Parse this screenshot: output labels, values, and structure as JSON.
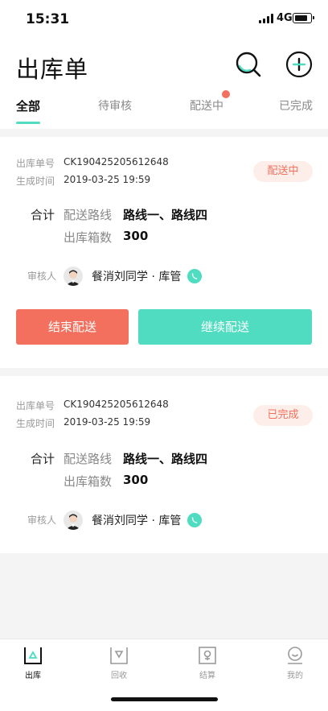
{
  "status_bar": {
    "time": "15:31",
    "network": "4G"
  },
  "header": {
    "title": "出库单"
  },
  "tabs": [
    {
      "label": "全部",
      "active": true
    },
    {
      "label": "待审核",
      "active": false
    },
    {
      "label": "配送中",
      "active": false,
      "has_dot": true
    },
    {
      "label": "已完成",
      "active": false
    }
  ],
  "colors": {
    "accent": "#4fdcc0",
    "warning": "#f2705d"
  },
  "orders": [
    {
      "order_no_label": "出库单号",
      "order_no": "CK190425205612648",
      "created_label": "生成时间",
      "created": "2019-03-25 19:59",
      "status": "配送中",
      "total_label": "合计",
      "route_label": "配送路线",
      "route": "路线一、路线四",
      "boxes_label": "出库箱数",
      "boxes": "300",
      "auditor_label": "审核人",
      "auditor": "餐消刘同学 · 库管",
      "end_button": "结束配送",
      "continue_button": "继续配送"
    },
    {
      "order_no_label": "出库单号",
      "order_no": "CK190425205612648",
      "created_label": "生成时间",
      "created": "2019-03-25 19:59",
      "status": "已完成",
      "total_label": "合计",
      "route_label": "配送路线",
      "route": "路线一、路线四",
      "boxes_label": "出库箱数",
      "boxes": "300",
      "auditor_label": "审核人",
      "auditor": "餐消刘同学 · 库管"
    }
  ],
  "tabbar": [
    {
      "label": "出库",
      "icon": "outbound-icon",
      "active": true
    },
    {
      "label": "回收",
      "icon": "recycle-icon",
      "active": false
    },
    {
      "label": "结算",
      "icon": "settlement-icon",
      "active": false
    },
    {
      "label": "我的",
      "icon": "profile-icon",
      "active": false
    }
  ]
}
